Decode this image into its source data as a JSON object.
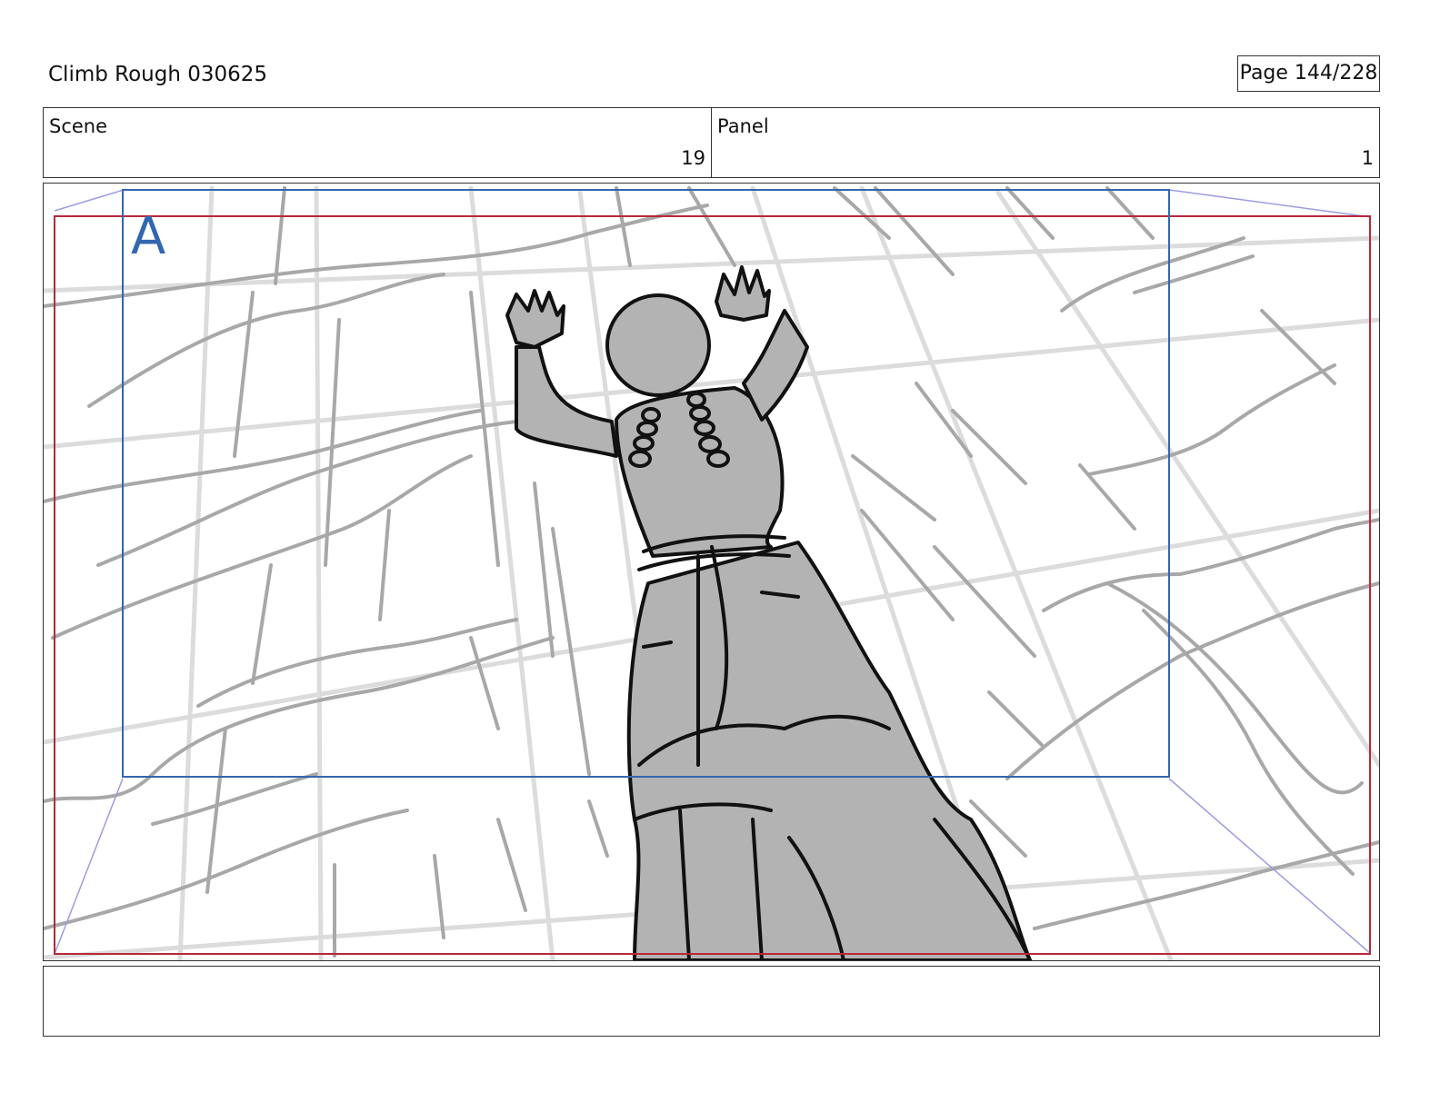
{
  "header": {
    "title": "Climb Rough 030625",
    "page_label": "Page 144/228"
  },
  "info": {
    "scene_label": "Scene",
    "scene_value": "19",
    "panel_label": "Panel",
    "panel_value": "1"
  },
  "panel": {
    "camera_mark": "A",
    "colors": {
      "camera_frame": "#3366b0",
      "safe_frame": "#b8283a",
      "perspective_guides": "#9c9ce0",
      "figure_fill": "#b3b3b3",
      "rock_lines": "#a6a6a6",
      "ink": "#111111"
    },
    "icons": [
      "climber-figure-sketch",
      "rock-wall-sketch"
    ]
  },
  "notes": {
    "text": ""
  }
}
